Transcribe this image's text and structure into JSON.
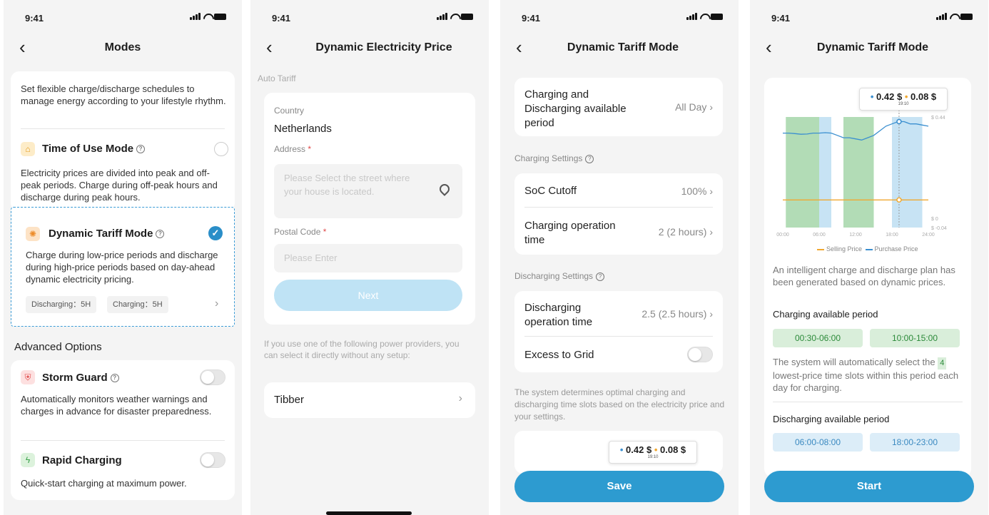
{
  "status": {
    "time": "9:41"
  },
  "modes": {
    "title": "Modes",
    "intro": "Set flexible charge/discharge schedules to manage energy according to your lifestyle rhythm.",
    "tou": {
      "title": "Time of Use Mode",
      "desc": "Electricity prices are divided into peak and off-peak periods. Charge during off-peak hours and discharge during peak hours."
    },
    "dynamic": {
      "title": "Dynamic Tariff Mode",
      "desc": "Charge during low-price periods and discharge during high-price periods based on day-ahead dynamic electricity pricing.",
      "discharging_chip": "Discharging：5H",
      "charging_chip": "Charging：5H"
    },
    "advanced_title": "Advanced Options",
    "storm": {
      "title": "Storm Guard",
      "desc": "Automatically monitors weather warnings and charges in advance for disaster preparedness."
    },
    "rapid": {
      "title": "Rapid Charging",
      "desc": "Quick-start charging at maximum power."
    }
  },
  "price": {
    "title": "Dynamic Electricity Price",
    "section": "Auto Tariff",
    "country_label": "Country",
    "country_value": "Netherlands",
    "address_label": "Address",
    "address_placeholder": "Please Select the street where your house is located.",
    "postal_label": "Postal Code",
    "postal_placeholder": "Please Enter",
    "required_mark": "*",
    "next_label": "Next",
    "providers_text": "If you use one of the following power providers, you can select it directly without any setup:",
    "provider": "Tibber"
  },
  "tariff": {
    "title": "Dynamic Tariff Mode",
    "period_label": "Charging and Discharging available period",
    "period_value": "All Day",
    "charging_settings": "Charging Settings",
    "soc_label": "SoC Cutoff",
    "soc_value": "100%",
    "charge_time_label": "Charging operation time",
    "charge_time_value": "2 (2 hours)",
    "discharging_settings": "Discharging Settings",
    "discharge_time_label": "Discharging operation time",
    "discharge_time_value": "2.5 (2.5 hours)",
    "excess_label": "Excess to Grid",
    "info": "The system determines optimal charging and discharging time slots based on the electricity price and your settings.",
    "tooltip_purchase": "0.42 $",
    "tooltip_selling": "0.08 $",
    "tooltip_time": "19:10",
    "save_label": "Save"
  },
  "plan": {
    "title": "Dynamic Tariff Mode",
    "tooltip_purchase": "0.42 $",
    "tooltip_selling": "0.08 $",
    "tooltip_time": "19:10",
    "description": "An intelligent charge and discharge plan has been generated based on dynamic prices.",
    "charging_period_title": "Charging available period",
    "charging_slots": [
      "00:30-06:00",
      "10:00-15:00"
    ],
    "auto_select_pre": "The system will automatically select the",
    "auto_select_count": "4",
    "auto_select_post": "lowest-price time slots within this period each day for charging.",
    "discharging_period_title": "Discharging available period",
    "discharging_slots": [
      "06:00-08:00",
      "18:00-23:00"
    ],
    "start_label": "Start"
  },
  "chart_data": {
    "type": "line",
    "x_ticks": [
      "00:00",
      "06:00",
      "12:00",
      "18:00",
      "24:00"
    ],
    "y_tick_labels": [
      "$ 0.44",
      "$ 0",
      "$ -0.04"
    ],
    "legend": [
      "Selling Price",
      "Purchase Price"
    ],
    "legend_placement": "bottom",
    "colors": {
      "selling": "#f0a830",
      "purchase": "#3a8fd0",
      "charge_band": "#9fd3a4",
      "discharge_band": "#b9dcf1"
    },
    "x_hours": [
      0,
      1,
      2,
      3,
      4,
      5,
      6,
      7,
      8,
      9,
      10,
      11,
      12,
      13,
      14,
      15,
      16,
      17,
      18,
      19,
      20,
      21,
      22,
      23,
      24
    ],
    "series": [
      {
        "name": "Purchase Price",
        "values": [
          0.37,
          0.37,
          0.368,
          0.365,
          0.366,
          0.37,
          0.37,
          0.372,
          0.37,
          0.36,
          0.35,
          0.35,
          0.345,
          0.34,
          0.35,
          0.36,
          0.38,
          0.4,
          0.41,
          0.42,
          0.42,
          0.41,
          0.41,
          0.405,
          0.4
        ]
      },
      {
        "name": "Selling Price",
        "values": [
          0.08,
          0.08,
          0.08,
          0.08,
          0.08,
          0.08,
          0.08,
          0.08,
          0.08,
          0.08,
          0.08,
          0.08,
          0.08,
          0.08,
          0.08,
          0.08,
          0.08,
          0.08,
          0.08,
          0.08,
          0.08,
          0.08,
          0.08,
          0.08,
          0.08
        ]
      }
    ],
    "charge_bands": [
      [
        0.5,
        6
      ],
      [
        10,
        15
      ]
    ],
    "discharge_bands": [
      [
        6,
        8
      ],
      [
        18,
        23
      ]
    ],
    "ylim": [
      -0.04,
      0.44
    ],
    "cursor_hour": 19.17
  }
}
